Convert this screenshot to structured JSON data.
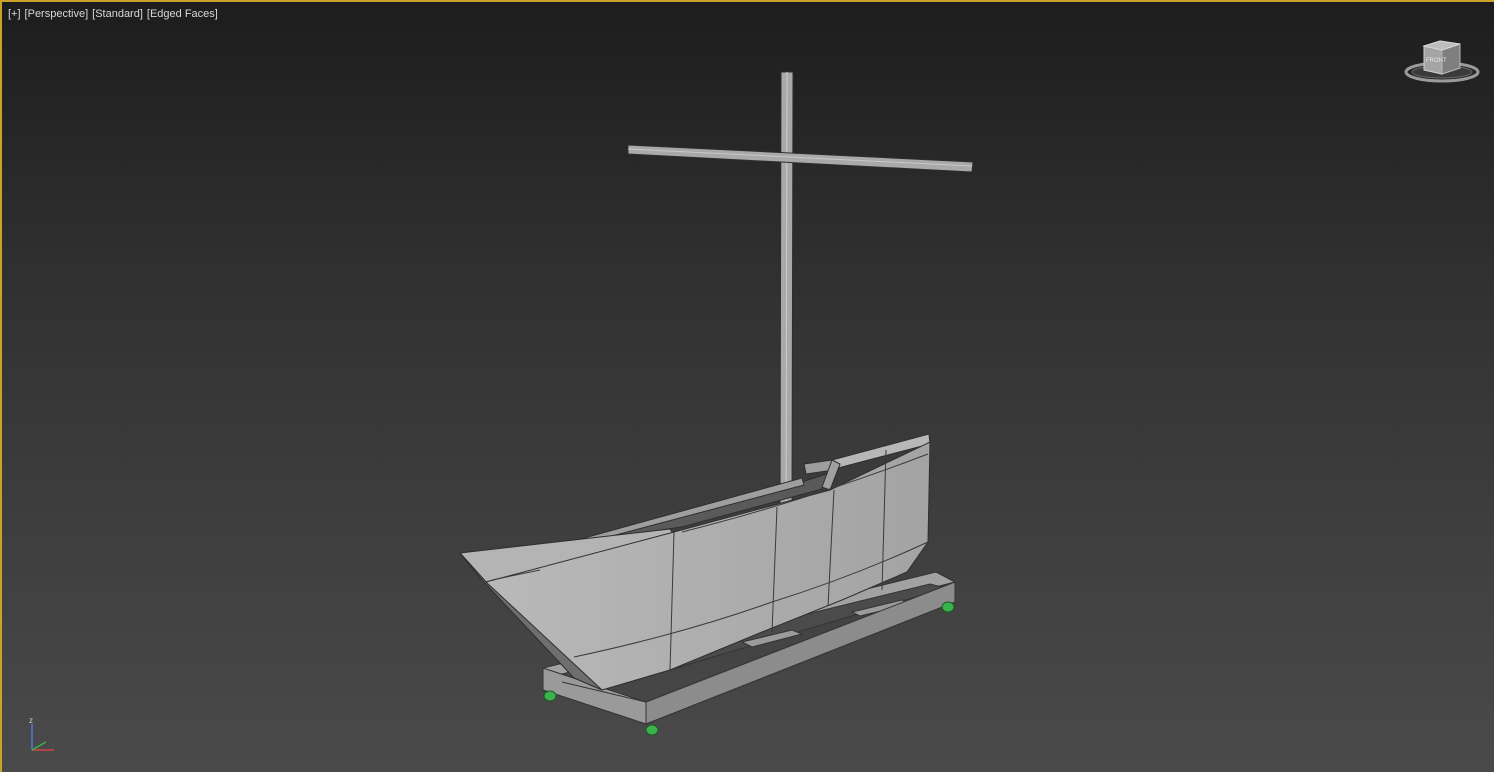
{
  "viewport": {
    "label_plus": "[+]",
    "label_view": "[Perspective]",
    "label_shading": "[Standard]",
    "label_edges": "[Edged Faces]"
  },
  "viewcube": {
    "icon": "viewcube-icon",
    "face_label": "FRONT"
  },
  "axis": {
    "icon": "axis-tripod-icon",
    "z_label": "z"
  },
  "colors": {
    "border_active": "#c9a227",
    "mesh_face": "#a8a8a8",
    "mesh_edge": "#3a3a3a",
    "wheel": "#3bb34a"
  },
  "scene_objects": [
    "boat-hull",
    "mast",
    "yard-arm",
    "cart-frame",
    "wheels"
  ]
}
